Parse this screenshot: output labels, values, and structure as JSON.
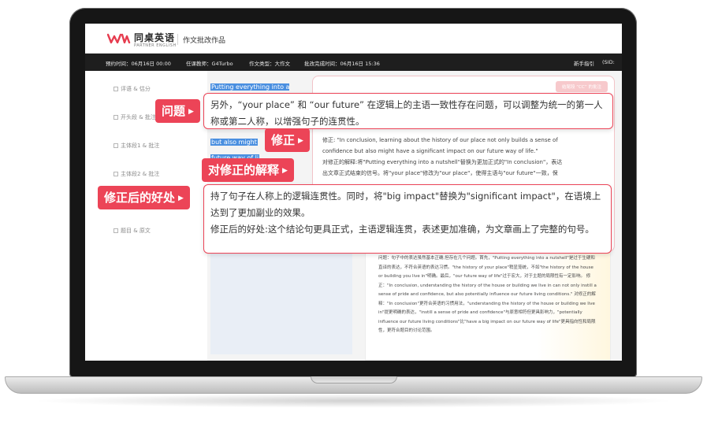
{
  "app": {
    "logo_main": "同桌英语",
    "logo_sub": "PARTNER ENGLISH",
    "page_title": "作文批改作品"
  },
  "info_bar": {
    "submit_time": "预约时间：06月16日 00:00",
    "teacher": "任课教师：G4Turbo",
    "essay_type": "作文类型：大作文",
    "finish_time": "批改完成时间：06月16日 15:36",
    "guide": "新手指引",
    "sid": "(SID:"
  },
  "sidebar": {
    "items": [
      {
        "label": "评语 & 估分"
      },
      {
        "label": "开头段 & 批注"
      },
      {
        "label": "主体段1 & 批注"
      },
      {
        "label": "主体段2 & 批注"
      },
      {
        "label": "题目 & 原文"
      }
    ]
  },
  "essay": {
    "line1": "Putting everything into a nut",
    "line2": "but also might",
    "line3": "future way of li"
  },
  "comment": {
    "tag": "结尾段 “CC” 的批注",
    "fix_text_1": "修正: \"In conclusion, learning about the history of our place not only builds a sense of",
    "fix_text_2": "confidence but also might have a significant impact on our future way of life.\"",
    "explain_text_1": "对修正的解释:将\"Putting everything into a nutshell\"替换为更加正式的\"In conclusion\"，表达",
    "explain_text_2": "出文章正式结束的信号。将\"your place\"修改为\"our place\"，使得主语与\"our future\"一致，保"
  },
  "comment2": {
    "text": "问题：句子中的表达虽然基本正确,但存在几个问题。首先，\"Putting everything into a nutshell\"是过于生硬和直译的表达，不符合英语的表达习惯。\"the history of your place\"稍显笼统，不如\"the history of the house or building you live in\"明确。最后，\"our future way of life\"过于宏大，对于主题的局限性有一定影响。 修正：\"In conclusion, understanding the history of the house or building we live in can not only instill a sense of pride and confidence, but also potentially influence our future living conditions.\" 对修正的解释：\"In conclusion\"更符合英语的习惯用法，\"understanding the history of the house or building we live in\"提更明确的表达，\"instill a sense of pride and confidence\"与原意相符但更具影响力，\"potentially influence our future living conditions\"比\"have a big impact on our future way of life\"更具指向性和局限性，更符合题目的讨论范围。"
  },
  "labels": {
    "problem": "问题",
    "fix": "修正",
    "explain": "对修正的解释",
    "benefit": "修正后的好处"
  },
  "bubbles": {
    "problem": "另外，“your place” 和 “our future” 在逻辑上的主语一致性存在问题，可以调整为统一的第一人称或第二人称，以增强句子的连贯性。",
    "benefit_1": "持了句子在人称上的逻辑连贯性。同时，将\"big impact\"替换为\"significant impact\"，在语境上达到了更加副业的效果。",
    "benefit_2": "修正后的好处:这个结论句更具正式，主语逻辑连贯，表述更加准确，为文章画上了完整的句号。"
  },
  "colors": {
    "accent_red": "#ec4457",
    "highlight_blue": "#4a8fe0",
    "info_bar_bg": "#1e1e1e"
  }
}
